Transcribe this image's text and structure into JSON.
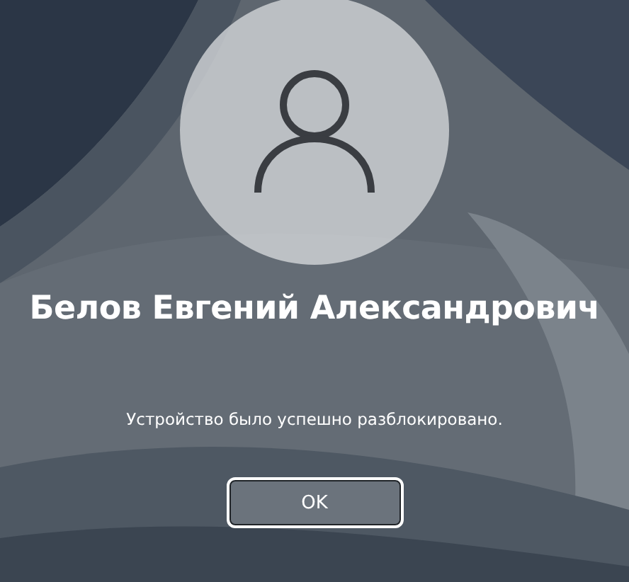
{
  "user": {
    "name": "Белов Евгений Александрович"
  },
  "message": "Устройство было успешно разблокировано.",
  "buttons": [
    {
      "label": "OK",
      "focused": true
    }
  ]
}
